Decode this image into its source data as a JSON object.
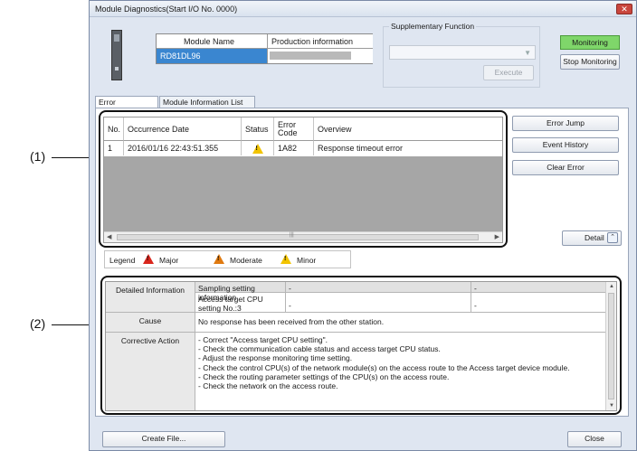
{
  "callouts": {
    "one": "(1)",
    "two": "(2)"
  },
  "window": {
    "title": "Module Diagnostics(Start I/O No. 0000)",
    "close_glyph": "✕"
  },
  "module_info": {
    "name_header": "Module Name",
    "production_header": "Production information",
    "name_value": "RD81DL96",
    "production_value": ""
  },
  "supplementary": {
    "legend": "Supplementary Function",
    "select_value": "",
    "execute_label": "Execute"
  },
  "monitoring": {
    "status": "Monitoring",
    "stop_label": "Stop Monitoring"
  },
  "tabs": [
    {
      "label": "Error Information",
      "active": true
    },
    {
      "label": "Module Information List",
      "active": false
    }
  ],
  "error_table": {
    "headers": {
      "no": "No.",
      "date": "Occurrence Date",
      "status": "Status",
      "code": "Error Code",
      "overview": "Overview"
    },
    "rows": [
      {
        "no": "1",
        "date": "2016/01/16 22:43:51.355",
        "status_icon": "minor-warning-icon",
        "code": "1A82",
        "overview": "Response timeout error"
      }
    ]
  },
  "side_buttons": {
    "error_jump": "Error Jump",
    "event_history": "Event History",
    "clear_error": "Clear Error",
    "detail": "Detail"
  },
  "legend": {
    "title": "Legend",
    "major": "Major",
    "moderate": "Moderate",
    "minor": "Minor"
  },
  "details": {
    "detailed_label": "Detailed Information",
    "col1_header": "Sampling setting information",
    "col2_header": "-",
    "col3_header": "-",
    "row_label": "Access target CPU setting No.:3",
    "row_val2": "-",
    "row_val3": "-",
    "cause_label": "Cause",
    "cause_text": "No response has been received from the other station.",
    "corrective_label": "Corrective Action",
    "corrective_text": "- Correct \"Access target CPU setting\".\n- Check the communication cable status and access target CPU status.\n- Adjust the response monitoring time setting.\n- Check the control CPU(s) of the network module(s) on the access route to the Access target device module.\n- Check the routing parameter settings of the CPU(s) on the access route.\n- Check the network on the access route."
  },
  "footer": {
    "create_file": "Create File...",
    "close": "Close"
  },
  "colors": {
    "monitoring_green": "#7fd66a",
    "selection_blue": "#3a86d0",
    "minor_yellow": "#f2c400",
    "moderate_orange": "#e07a10",
    "major_red": "#d9261c"
  }
}
